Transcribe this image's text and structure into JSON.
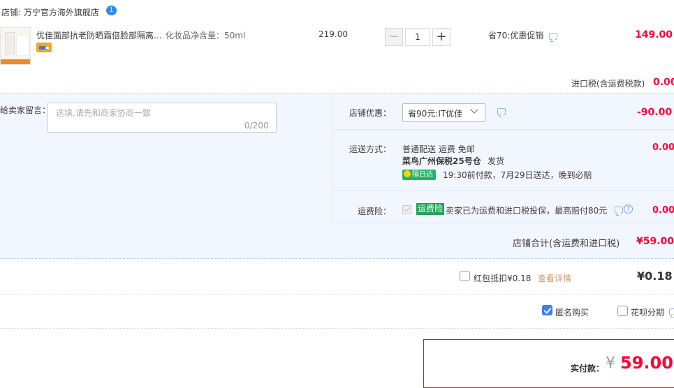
{
  "shop": {
    "label": "店铺: 万宁官方海外旗舰店",
    "badge": "1"
  },
  "item": {
    "title": "优佳面部抗老防晒霜倍脸部隔离...",
    "spec": "化妆品净含量：50ml",
    "unit_price": "219.00",
    "quantity": "1",
    "qty_minus": "−",
    "qty_plus": "+",
    "promo": "省70:优惠促销",
    "total": "149.00"
  },
  "tax": {
    "label": "进口税(含运费税款)",
    "value": "0.00"
  },
  "memo": {
    "label": "给卖家留言：",
    "placeholder": "选填,请先和商家协商一致",
    "count": "0/200"
  },
  "coupon": {
    "label": "店铺优惠：",
    "selected": "省90元:IT优佳",
    "amount": "-90.00"
  },
  "shipping": {
    "label": "运送方式：",
    "line1": "普通配送 运费 免邮",
    "warehouse": "菜鸟广州保税25号仓",
    "warehouse_note": "发货",
    "tag": "隔日达",
    "promise": "19:30前付款，7月29日送达，晚到必赔",
    "amount": "0.00"
  },
  "insurance": {
    "label": "运费险：",
    "tag": "运费险",
    "desc": "卖家已为运费和进口税投保，最高赔付80元",
    "help": "?",
    "amount": "0.00"
  },
  "store_total": {
    "label": "店铺合计(含运费和进口税)",
    "value": "¥59.00"
  },
  "red_packet": {
    "label": "红包抵扣¥0.18",
    "link": "查看详情",
    "value": "¥0.18"
  },
  "options": {
    "anonymous": "匿名购买",
    "installment": "花呗分期"
  },
  "payment": {
    "label": "实付款：",
    "currency": "¥",
    "amount": "59.00"
  },
  "colors": {
    "price_red": "#ff0036",
    "panel_bg": "#f2f7ff",
    "checkbox_blue": "#3b7ff5",
    "tag_green": "#23b46a"
  }
}
